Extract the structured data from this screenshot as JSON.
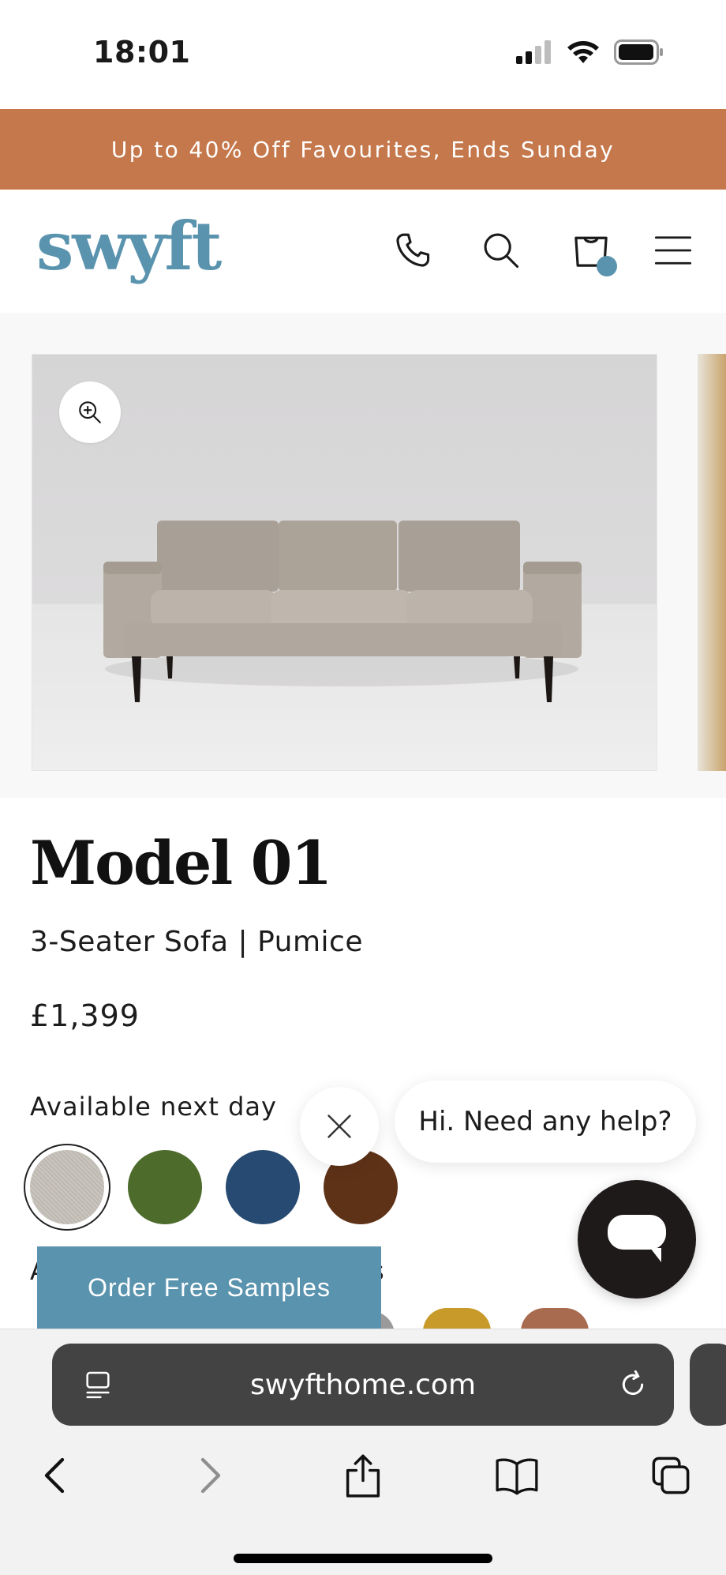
{
  "status_bar": {
    "time": "18:01"
  },
  "promo_banner": {
    "text": "Up to 40% Off Favourites, Ends Sunday"
  },
  "header": {
    "logo": "swyft",
    "icons": [
      "phone-icon",
      "search-icon",
      "cart-icon",
      "menu-icon"
    ],
    "cart_indicator_color": "#5a93ae"
  },
  "product": {
    "title": "Model 01",
    "subtitle": "3-Seater Sofa | Pumice",
    "price": "£1,399",
    "availability": "Available next day",
    "swatches": [
      {
        "name": "Pumice",
        "color": "#c5c0b8",
        "selected": true
      },
      {
        "name": "Olive",
        "color": "#4d6b2b",
        "selected": false
      },
      {
        "name": "Navy",
        "color": "#274a72",
        "selected": false
      },
      {
        "name": "Brown",
        "color": "#5e3217",
        "selected": false
      }
    ],
    "partial_label_left": "A",
    "partial_label_right": "s"
  },
  "samples_button": {
    "label": "Order Free Samples"
  },
  "chat": {
    "greeting": "Hi. Need any help?"
  },
  "browser": {
    "url": "swyfthome.com"
  },
  "colors": {
    "brand": "#5a93ae",
    "promo": "#c5784b",
    "chat_launcher": "#1d1a19"
  }
}
